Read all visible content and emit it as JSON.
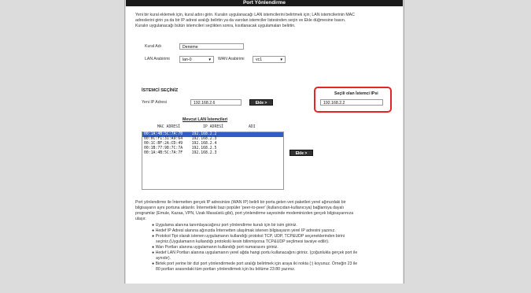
{
  "page": {
    "title": "Port Yönlendirme"
  },
  "intro": [
    "Yeni bir kural eklemek için, kural adını girin. Kuralın uygulanacağı LAN istemcilerini belirtmek için; LAN istemcilerinin MAC",
    "adreslerini girin ya da bir IP adresi aralığı belirtin ya da varolan istemciler listesinden seçin ve Ekle düğmesine basın.",
    "Kuralın uygulanacağı bütün istemcileri seçtikten sonra, kısıtlanacak uygulamaları belirtin."
  ],
  "rule": {
    "name_label": "Kural Adı",
    "name_value": "Deneme"
  },
  "interfaces": {
    "lan_label": "LAN Arabirimi",
    "lan_value": "lan-0",
    "wan_label": "WAN Arabirimi",
    "wan_value": "vc1",
    "arrow": "▼"
  },
  "client": {
    "section_title": "İSTEMCİ SEÇİNİZ",
    "new_ip_label": "Yeni IP Adresi",
    "new_ip_value": "192.168.2.6",
    "add_label": "Ekle >",
    "selected_title": "Seçili olan İstemci IPsi",
    "selected_value": "192.168.2.2",
    "existing_title": "Mevcut LAN İstemcileri",
    "col_mac": "MAC ADRESİ",
    "col_ip": "IP ADRESİ",
    "col_name": "ADI",
    "rows": [
      "00:1A:4B:5C:7A:70    192.168.2.2",
      "00:0C:F1:31:A9:64    192.168.2.3",
      "00:1C:BF:2A:CD:49    192.168.2.4",
      "00:1B:77:98:7C:7A    192.168.2.5",
      "00:1A:4B:5C:7A:7F    192.168.2.3"
    ],
    "list_add_label": "Ekle >"
  },
  "description": [
    "Port yönlendirme ile İnternetten gerçek IP adresinize (WAN IP) belirli bir porta gelen veri paketleri yerel ağınızdaki bir",
    "bilgisayarın aynı portuna aktarılır. İnternetteki bazı popüler 'peer-to-peer' (kullanıcıdan-kullanıcıya) bağlantıya dayalı",
    "programlar (Emule, Kazaa, VPN, Uzak Masaüstü gibi), port yönlendirme sayesinde modeminizden gerçek bilgisayarınıza",
    "ulaşır."
  ],
  "bullets": [
    "●  Uygulama alanına tanımlayacağınız port yönlendirme kuralı için bir isim giriniz.",
    "●  Hedef IP Adresi alanına ağınızda İnternetten ulaşılmak istenen bilgisayarın yerel IP adresini yazınız.",
    "●  Protokol Tipi olarak istenen uygulamanın kullandığı protokol TCP, UDP, TCP&UDP seçeneklerinden birini",
    "seçiniz.(Uygulamanın kullandığı protokolü kesin bilinmiyorsa TCP&UDP seçilmesi tavsiye edilir).",
    "●  Wan Portları alanına uygulamanın kullandığı port numarasını giriniz.",
    "●  Hedef LAN Portları alanına uygulamanın yerel ağda hangi portu kullanacağını giriniz. (çoğunlukla gerçek port ile",
    "aynıdır).",
    "●  Birtek port yerine bir dizi port yönlendirmede port aralığı belirtmek için araya iki nokta (:) koyunuz. Örneğin 23 ile",
    "80 portları arasındaki tüm portları yönlendirmek için bu bölüme 23:80 yazınız."
  ]
}
